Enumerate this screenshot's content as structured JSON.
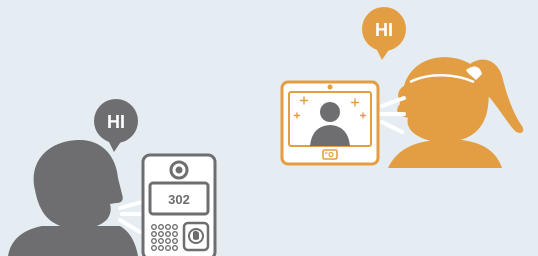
{
  "left_speaker": {
    "greeting": "HI",
    "color": "#6e6e70"
  },
  "right_speaker": {
    "greeting": "HI",
    "color": "#e39e44"
  },
  "intercom_panel": {
    "display_text": "302",
    "icon": "user-head-icon"
  },
  "video_monitor": {
    "caller_icon": "user-avatar-icon",
    "sparkle_icon": "sparkle-icon",
    "camera_icon": "camera-icon"
  },
  "colors": {
    "background": "#e6edf2",
    "gray": "#6e6e70",
    "orange": "#e39e44"
  }
}
